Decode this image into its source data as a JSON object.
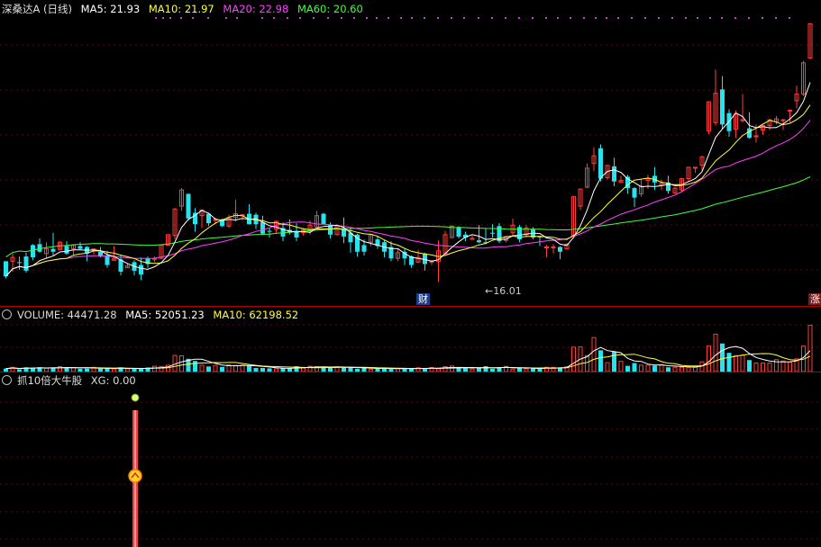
{
  "colors": {
    "up": "#ff3b3b",
    "down": "#27e3f0",
    "ma5": "#ffffff",
    "ma10": "#ffff40",
    "ma20": "#ff40ff",
    "ma60": "#40ff40",
    "grid": "#7a0000"
  },
  "main": {
    "title": "深桑达A (日线)",
    "ma5_label": "MA5: 21.93",
    "ma10_label": "MA10: 21.97",
    "ma20_label": "MA20: 22.98",
    "ma60_label": "MA60: 20.60",
    "low_price_label": "16.01",
    "finance_marker": "财",
    "rise_marker": "涨"
  },
  "volume": {
    "label": "VOLUME: 44471.28",
    "ma5_label": "MA5: 52051.23",
    "ma10_label": "MA10: 62198.52"
  },
  "indicator": {
    "label": "抓10倍大牛股",
    "xg_label": "XG: 0.00"
  },
  "candles": [
    [
      0,
      [
        12.5,
        12.3,
        10.9,
        10.7
      ]
    ],
    [
      1,
      [
        12.9,
        13.3,
        12.5,
        11.4
      ]
    ],
    [
      0,
      [
        12.4,
        13.0,
        12.4,
        11.6
      ]
    ],
    [
      0,
      [
        13.0,
        13.4,
        11.5,
        11.3
      ]
    ],
    [
      0,
      [
        14.2,
        14.3,
        12.9,
        12.6
      ]
    ],
    [
      0,
      [
        14.3,
        14.9,
        13.5,
        13.4
      ]
    ],
    [
      1,
      [
        13.3,
        14.5,
        13.8,
        12.8
      ]
    ],
    [
      0,
      [
        13.8,
        15.5,
        13.5,
        13.1
      ]
    ],
    [
      1,
      [
        14.5,
        14.6,
        13.7,
        13.7
      ]
    ],
    [
      0,
      [
        14.1,
        14.6,
        13.3,
        13.2
      ]
    ],
    [
      1,
      [
        13.8,
        14.2,
        14.2,
        13.1
      ]
    ],
    [
      0,
      [
        14.1,
        14.5,
        13.8,
        13.7
      ]
    ],
    [
      0,
      [
        14.0,
        14.1,
        13.3,
        12.5
      ]
    ],
    [
      1,
      [
        13.8,
        13.8,
        13.8,
        13.2
      ]
    ],
    [
      0,
      [
        13.5,
        14.0,
        13.0,
        12.9
      ]
    ],
    [
      0,
      [
        13.1,
        13.6,
        12.1,
        11.8
      ]
    ],
    [
      1,
      [
        12.6,
        14.1,
        12.8,
        12.6
      ]
    ],
    [
      0,
      [
        12.7,
        13.2,
        11.4,
        11.0
      ]
    ],
    [
      1,
      [
        11.8,
        12.3,
        12.0,
        11.8
      ]
    ],
    [
      0,
      [
        12.4,
        12.6,
        11.5,
        11.0
      ]
    ],
    [
      0,
      [
        12.1,
        12.9,
        11.1,
        10.5
      ]
    ],
    [
      0,
      [
        12.8,
        13.0,
        12.2,
        11.8
      ]
    ],
    [
      1,
      [
        12.8,
        13.0,
        12.8,
        12.4
      ]
    ],
    [
      1,
      [
        12.8,
        14.3,
        14.2,
        12.7
      ]
    ],
    [
      1,
      [
        14.2,
        15.3,
        15.3,
        14.2
      ]
    ],
    [
      1,
      [
        15.2,
        18.1,
        18.0,
        14.8
      ]
    ],
    [
      1,
      [
        18.3,
        20.2,
        20.0,
        17.8
      ]
    ],
    [
      0,
      [
        19.6,
        19.6,
        17.0,
        16.8
      ]
    ],
    [
      0,
      [
        17.6,
        18.1,
        16.4,
        15.6
      ]
    ],
    [
      1,
      [
        17.3,
        17.9,
        17.9,
        16.0
      ]
    ],
    [
      0,
      [
        17.5,
        17.6,
        16.5,
        16.2
      ]
    ],
    [
      1,
      [
        16.8,
        17.1,
        16.9,
        16.4
      ]
    ],
    [
      0,
      [
        16.9,
        17.0,
        16.2,
        16.1
      ]
    ],
    [
      1,
      [
        16.2,
        17.4,
        17.1,
        16.0
      ]
    ],
    [
      1,
      [
        17.1,
        19.0,
        17.5,
        16.7
      ]
    ],
    [
      1,
      [
        17.3,
        17.4,
        17.4,
        16.8
      ]
    ],
    [
      0,
      [
        17.5,
        18.5,
        16.4,
        16.4
      ]
    ],
    [
      0,
      [
        17.4,
        17.6,
        16.4,
        15.9
      ]
    ],
    [
      0,
      [
        16.6,
        17.3,
        15.4,
        15.3
      ]
    ],
    [
      0,
      [
        15.7,
        16.0,
        15.6,
        15.0
      ]
    ],
    [
      1,
      [
        15.9,
        16.8,
        16.7,
        15.4
      ]
    ],
    [
      0,
      [
        16.0,
        16.6,
        15.1,
        14.6
      ]
    ],
    [
      0,
      [
        15.8,
        16.9,
        15.5,
        15.3
      ]
    ],
    [
      0,
      [
        15.7,
        16.5,
        15.0,
        14.6
      ]
    ],
    [
      1,
      [
        15.5,
        16.0,
        15.8,
        15.2
      ]
    ],
    [
      1,
      [
        15.8,
        16.8,
        16.3,
        15.3
      ]
    ],
    [
      1,
      [
        16.1,
        17.8,
        17.3,
        15.9
      ]
    ],
    [
      0,
      [
        17.5,
        17.6,
        16.4,
        16.4
      ]
    ],
    [
      0,
      [
        16.3,
        16.6,
        15.3,
        14.9
      ]
    ],
    [
      1,
      [
        15.3,
        16.3,
        16.2,
        15.2
      ]
    ],
    [
      0,
      [
        16.0,
        17.1,
        15.1,
        14.4
      ]
    ],
    [
      0,
      [
        15.5,
        15.9,
        14.5,
        13.4
      ]
    ],
    [
      0,
      [
        15.3,
        15.4,
        13.5,
        13.0
      ]
    ],
    [
      0,
      [
        14.2,
        14.8,
        13.5,
        13.1
      ]
    ],
    [
      1,
      [
        14.5,
        15.3,
        15.3,
        14.1
      ]
    ],
    [
      0,
      [
        14.8,
        15.2,
        14.1,
        13.8
      ]
    ],
    [
      0,
      [
        14.5,
        14.7,
        13.5,
        12.9
      ]
    ],
    [
      0,
      [
        14.0,
        14.6,
        12.8,
        12.5
      ]
    ],
    [
      1,
      [
        12.8,
        13.8,
        13.4,
        12.5
      ]
    ],
    [
      0,
      [
        13.5,
        13.8,
        12.8,
        12.1
      ]
    ],
    [
      0,
      [
        13.0,
        13.1,
        12.1,
        11.8
      ]
    ],
    [
      1,
      [
        12.4,
        13.7,
        12.9,
        12.3
      ]
    ],
    [
      0,
      [
        13.3,
        13.4,
        12.2,
        11.5
      ]
    ],
    [
      1,
      [
        12.4,
        12.6,
        12.5,
        12.1
      ]
    ],
    [
      1,
      [
        12.5,
        14.7,
        13.6,
        10.3
      ]
    ],
    [
      1,
      [
        13.3,
        15.7,
        15.3,
        13.2
      ]
    ],
    [
      1,
      [
        15.0,
        16.3,
        16.2,
        14.9
      ]
    ],
    [
      0,
      [
        16.1,
        16.2,
        15.1,
        14.9
      ]
    ],
    [
      0,
      [
        15.3,
        15.6,
        15.0,
        14.6
      ]
    ],
    [
      1,
      [
        14.9,
        15.2,
        14.9,
        14.9
      ]
    ],
    [
      0,
      [
        14.7,
        16.3,
        14.5,
        14.4
      ]
    ],
    [
      0,
      [
        14.5,
        16.0,
        14.5,
        14.3
      ]
    ],
    [
      0,
      [
        15.5,
        16.4,
        15.4,
        15.0
      ]
    ],
    [
      0,
      [
        16.2,
        16.5,
        14.6,
        14.4
      ]
    ],
    [
      1,
      [
        14.7,
        15.1,
        15.1,
        14.5
      ]
    ],
    [
      1,
      [
        15.5,
        17.0,
        16.3,
        15.2
      ]
    ],
    [
      0,
      [
        16.1,
        16.3,
        14.8,
        14.5
      ]
    ],
    [
      1,
      [
        15.3,
        16.3,
        16.0,
        15.0
      ]
    ],
    [
      0,
      [
        15.9,
        16.1,
        15.0,
        14.8
      ]
    ],
    [
      0,
      [
        15.1,
        15.2,
        15.0,
        14.1
      ]
    ],
    [
      1,
      [
        14.0,
        14.2,
        14.0,
        12.9
      ]
    ],
    [
      1,
      [
        13.9,
        14.3,
        14.0,
        13.3
      ]
    ],
    [
      0,
      [
        14.0,
        14.1,
        13.5,
        12.7
      ]
    ],
    [
      1,
      [
        13.8,
        14.4,
        14.3,
        13.7
      ]
    ],
    [
      1,
      [
        15.2,
        19.3,
        19.3,
        15.1
      ]
    ],
    [
      1,
      [
        18.3,
        20.1,
        20.1,
        17.9
      ]
    ],
    [
      1,
      [
        20.3,
        22.8,
        22.3,
        20.2
      ]
    ],
    [
      1,
      [
        22.8,
        24.5,
        23.6,
        22.0
      ]
    ],
    [
      0,
      [
        24.4,
        24.8,
        21.2,
        20.9
      ]
    ],
    [
      1,
      [
        21.3,
        22.6,
        22.6,
        21.1
      ]
    ],
    [
      0,
      [
        22.5,
        23.4,
        20.9,
        20.4
      ]
    ],
    [
      1,
      [
        20.8,
        21.5,
        21.0,
        20.8
      ]
    ],
    [
      0,
      [
        21.4,
        21.6,
        20.2,
        19.6
      ]
    ],
    [
      0,
      [
        20.2,
        20.3,
        19.2,
        18.2
      ]
    ],
    [
      1,
      [
        19.6,
        21.2,
        20.4,
        19.3
      ]
    ],
    [
      1,
      [
        21.0,
        21.6,
        21.2,
        20.1
      ]
    ],
    [
      0,
      [
        21.5,
        22.4,
        20.8,
        20.0
      ]
    ],
    [
      1,
      [
        20.5,
        21.1,
        20.7,
        20.0
      ]
    ],
    [
      0,
      [
        20.8,
        21.5,
        19.9,
        19.6
      ]
    ],
    [
      1,
      [
        19.7,
        20.3,
        20.2,
        19.6
      ]
    ],
    [
      1,
      [
        20.0,
        21.2,
        21.2,
        19.8
      ]
    ],
    [
      1,
      [
        21.2,
        22.4,
        22.4,
        20.9
      ]
    ],
    [
      1,
      [
        22.4,
        22.4,
        22.3,
        21.8
      ]
    ],
    [
      1,
      [
        22.6,
        23.6,
        23.5,
        22.0
      ]
    ],
    [
      1,
      [
        26.2,
        29.3,
        29.3,
        25.9
      ]
    ],
    [
      1,
      [
        27.1,
        32.7,
        30.2,
        26.8
      ]
    ],
    [
      0,
      [
        30.6,
        32.0,
        26.9,
        26.4
      ]
    ],
    [
      0,
      [
        28.1,
        28.5,
        26.2,
        25.6
      ]
    ],
    [
      1,
      [
        26.4,
        28.4,
        28.0,
        25.5
      ]
    ],
    [
      1,
      [
        27.4,
        30.1,
        27.4,
        27.1
      ]
    ],
    [
      0,
      [
        26.5,
        28.2,
        25.5,
        25.4
      ]
    ],
    [
      1,
      [
        25.7,
        26.9,
        25.7,
        25.0
      ]
    ],
    [
      1,
      [
        26.3,
        26.9,
        26.8,
        25.8
      ]
    ],
    [
      1,
      [
        26.8,
        27.5,
        27.4,
        26.3
      ]
    ],
    [
      1,
      [
        27.2,
        27.8,
        27.5,
        26.9
      ]
    ],
    [
      1,
      [
        27.4,
        27.5,
        27.4,
        26.3
      ]
    ],
    [
      1,
      [
        28.4,
        28.5,
        28.3,
        27.1
      ]
    ],
    [
      1,
      [
        29.4,
        31.0,
        30.1,
        28.6
      ]
    ],
    [
      1,
      [
        30.1,
        33.6,
        33.4,
        29.9
      ]
    ],
    [
      1,
      [
        33.9,
        37.6,
        37.5,
        33.8
      ]
    ]
  ],
  "volumes": [
    [
      0,
      14
    ],
    [
      1,
      20
    ],
    [
      0,
      11
    ],
    [
      0,
      20
    ],
    [
      0,
      17
    ],
    [
      0,
      20
    ],
    [
      1,
      16
    ],
    [
      0,
      16
    ],
    [
      1,
      23
    ],
    [
      0,
      20
    ],
    [
      1,
      18
    ],
    [
      0,
      13
    ],
    [
      0,
      14
    ],
    [
      1,
      20
    ],
    [
      0,
      14
    ],
    [
      0,
      15
    ],
    [
      1,
      12
    ],
    [
      0,
      20
    ],
    [
      1,
      13
    ],
    [
      0,
      13
    ],
    [
      0,
      12
    ],
    [
      0,
      19
    ],
    [
      1,
      25
    ],
    [
      1,
      24
    ],
    [
      1,
      30
    ],
    [
      1,
      76
    ],
    [
      1,
      74
    ],
    [
      0,
      60
    ],
    [
      0,
      50
    ],
    [
      1,
      30
    ],
    [
      0,
      24
    ],
    [
      1,
      29
    ],
    [
      0,
      22
    ],
    [
      1,
      32
    ],
    [
      1,
      29
    ],
    [
      1,
      31
    ],
    [
      0,
      27
    ],
    [
      0,
      17
    ],
    [
      0,
      17
    ],
    [
      0,
      15
    ],
    [
      1,
      13
    ],
    [
      0,
      16
    ],
    [
      0,
      16
    ],
    [
      0,
      25
    ],
    [
      1,
      17
    ],
    [
      1,
      25
    ],
    [
      1,
      23
    ],
    [
      0,
      20
    ],
    [
      0,
      21
    ],
    [
      1,
      20
    ],
    [
      0,
      21
    ],
    [
      0,
      19
    ],
    [
      0,
      13
    ],
    [
      0,
      18
    ],
    [
      1,
      11
    ],
    [
      0,
      13
    ],
    [
      0,
      18
    ],
    [
      0,
      12
    ],
    [
      1,
      14
    ],
    [
      0,
      12
    ],
    [
      0,
      15
    ],
    [
      1,
      18
    ],
    [
      0,
      15
    ],
    [
      1,
      19
    ],
    [
      1,
      13
    ],
    [
      1,
      23
    ],
    [
      1,
      26
    ],
    [
      0,
      16
    ],
    [
      0,
      18
    ],
    [
      1,
      12
    ],
    [
      0,
      19
    ],
    [
      0,
      25
    ],
    [
      0,
      13
    ],
    [
      0,
      20
    ],
    [
      1,
      24
    ],
    [
      1,
      12
    ],
    [
      0,
      17
    ],
    [
      1,
      13
    ],
    [
      0,
      16
    ],
    [
      0,
      12
    ],
    [
      1,
      20
    ],
    [
      1,
      20
    ],
    [
      0,
      19
    ],
    [
      1,
      23
    ],
    [
      1,
      115
    ],
    [
      1,
      116
    ],
    [
      1,
      75
    ],
    [
      1,
      160
    ],
    [
      0,
      100
    ],
    [
      1,
      42
    ],
    [
      0,
      93
    ],
    [
      1,
      48
    ],
    [
      0,
      27
    ],
    [
      0,
      40
    ],
    [
      1,
      30
    ],
    [
      1,
      30
    ],
    [
      0,
      28
    ],
    [
      1,
      30
    ],
    [
      0,
      20
    ],
    [
      1,
      20
    ],
    [
      1,
      20
    ],
    [
      1,
      20
    ],
    [
      1,
      24
    ],
    [
      1,
      46
    ],
    [
      1,
      120
    ],
    [
      1,
      176
    ],
    [
      0,
      132
    ],
    [
      0,
      88
    ],
    [
      1,
      75
    ],
    [
      1,
      76
    ],
    [
      0,
      54
    ],
    [
      1,
      40
    ],
    [
      1,
      40
    ],
    [
      1,
      40
    ],
    [
      1,
      56
    ],
    [
      1,
      50
    ],
    [
      1,
      44
    ],
    [
      1,
      60
    ],
    [
      1,
      120
    ],
    [
      1,
      218
    ]
  ]
}
